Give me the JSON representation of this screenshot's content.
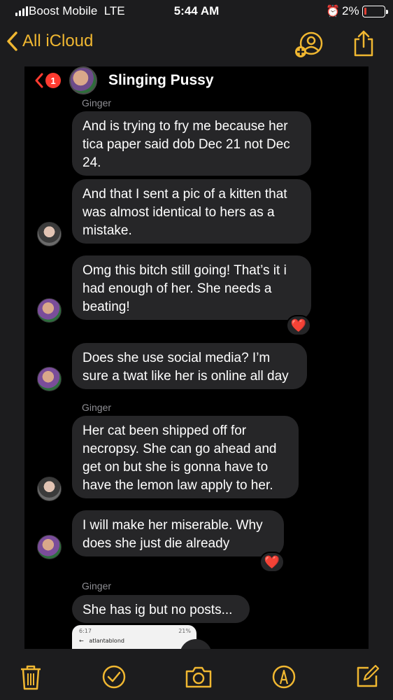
{
  "status_bar": {
    "carrier": "Boost Mobile",
    "network": "LTE",
    "time": "5:44 AM",
    "battery_percent": "2%",
    "battery_level": 0.02,
    "icons": [
      "signal-icon",
      "alarm-icon",
      "battery-icon"
    ]
  },
  "nav": {
    "back_label": "All iCloud",
    "icons": [
      "chevron-left-icon",
      "add-person-icon",
      "share-icon"
    ]
  },
  "colors": {
    "accent": "#f0b731",
    "background": "#1c1c1e",
    "bubble": "#262628",
    "badge": "#ff3b30",
    "reaction": "#ff3b30"
  },
  "chat": {
    "back_badge": "1",
    "group_name": "Slinging Pussy",
    "messages": [
      {
        "sender": "Ginger",
        "text": "And is trying to fry me because her tica paper said dob Dec 21 not Dec 24."
      },
      {
        "text": "And that I sent a pic of a kitten that was almost identical to hers as a mistake."
      },
      {
        "text": "Omg this bitch still going!  That’s it i had enough of her. She needs a beating!",
        "reaction": "❤️"
      },
      {
        "text": "Does she use social media?  I’m sure a twat like her is online all day"
      },
      {
        "sender": "Ginger",
        "text": "Her cat been shipped off for necropsy. She can go ahead and get on but she is gonna have to have the lemon law apply to her."
      },
      {
        "text": "I will make her miserable. Why does she just die already",
        "reaction": "❤️"
      },
      {
        "sender": "Ginger",
        "text": "She has ig but no posts..."
      }
    ],
    "attachment": {
      "time": "6:17",
      "status": "21%",
      "username": "atlantablond"
    }
  },
  "toolbar": {
    "icons": [
      "trash-icon",
      "checkmark-icon",
      "camera-icon",
      "markup-icon",
      "compose-icon"
    ]
  }
}
